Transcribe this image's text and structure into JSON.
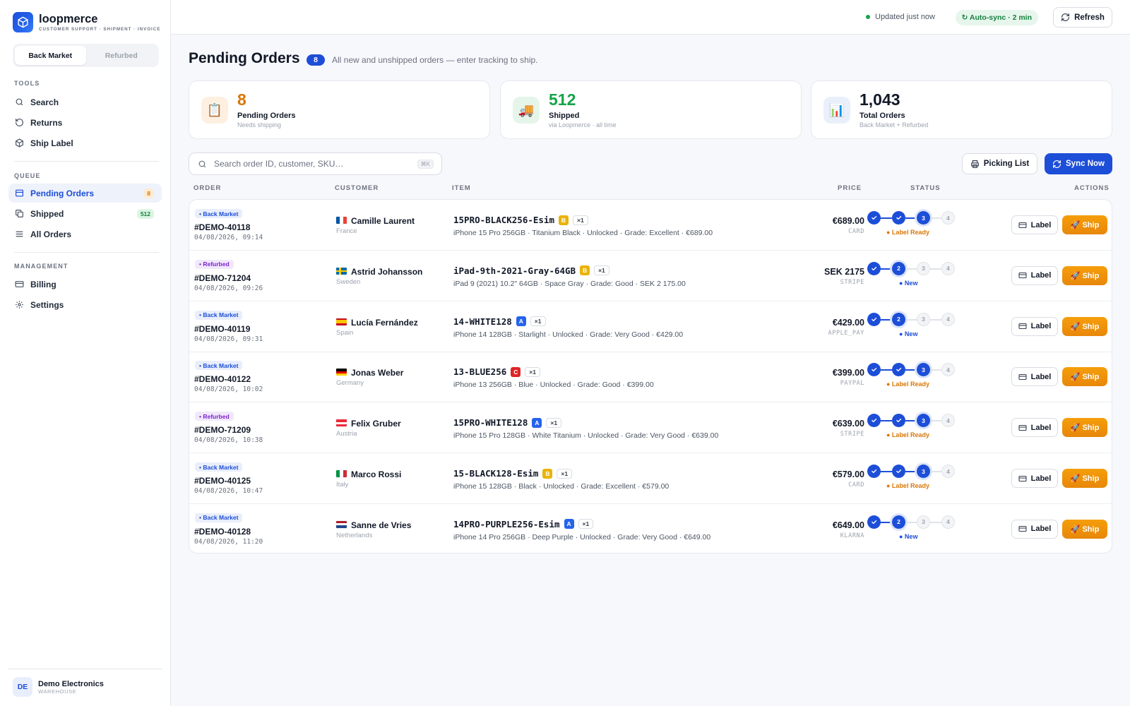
{
  "brand": {
    "name": "loopmerce",
    "tagline": "CUSTOMER SUPPORT · SHIPMENT · INVOICE"
  },
  "marketplace_tabs": [
    {
      "label": "Back Market",
      "active": true
    },
    {
      "label": "Refurbed",
      "active": false
    }
  ],
  "sidebar": {
    "tools_title": "TOOLS",
    "tools": [
      {
        "label": "Search",
        "icon": "search-icon"
      },
      {
        "label": "Returns",
        "icon": "undo-icon"
      },
      {
        "label": "Ship Label",
        "icon": "box-icon"
      }
    ],
    "queue_title": "QUEUE",
    "queue": [
      {
        "label": "Pending Orders",
        "icon": "inbox-icon",
        "badge": "8",
        "active": true
      },
      {
        "label": "Shipped",
        "icon": "copy-icon",
        "badge": "512",
        "active": false
      },
      {
        "label": "All Orders",
        "icon": "list-icon",
        "badge": "",
        "active": false
      }
    ],
    "management_title": "MANAGEMENT",
    "management": [
      {
        "label": "Billing",
        "icon": "credit-card-icon"
      },
      {
        "label": "Settings",
        "icon": "gear-icon"
      }
    ]
  },
  "org": {
    "initials": "DE",
    "name": "Demo Electronics",
    "role": "WAREHOUSE"
  },
  "topbar": {
    "updated": "Updated just now",
    "autosync": "↻ Auto-sync · 2 min",
    "refresh_label": "Refresh"
  },
  "page": {
    "title": "Pending Orders",
    "count": "8",
    "subtitle": "All new and unshipped orders — enter tracking to ship."
  },
  "stats": [
    {
      "value": "8",
      "label": "Pending Orders",
      "sub": "Needs shipping",
      "icon": "📋",
      "color": "#d97706",
      "bg": "#fdf0e1"
    },
    {
      "value": "512",
      "label": "Shipped",
      "sub": "via Loopmerce · all time",
      "icon": "🚚",
      "color": "#16a34a",
      "bg": "#e5f5ea"
    },
    {
      "value": "1,043",
      "label": "Total Orders",
      "sub": "Back Market + Refurbed",
      "icon": "📊",
      "color": "#111827",
      "bg": "#eaf0fb"
    }
  ],
  "toolbar": {
    "search_placeholder": "Search order ID, customer, SKU…",
    "shortcut": "⌘K",
    "picking_label": "Picking List",
    "sync_label": "Sync Now"
  },
  "table": {
    "headers": {
      "order": "ORDER",
      "customer": "CUSTOMER",
      "item": "ITEM",
      "price": "PRICE",
      "status": "STATUS",
      "actions": "ACTIONS"
    },
    "label_button": "Label",
    "ship_button": "🚀 Ship",
    "rows": [
      {
        "channel": "• Back Market",
        "channel_type": "bm",
        "order_id": "#DEMO-40118",
        "date": "04/08/2026, 09:14",
        "flag": "fr",
        "customer": "Camille Laurent",
        "country": "France",
        "sku": "15PRO-BLACK256-Esim",
        "grade": "B",
        "qty": "×1",
        "desc": "iPhone 15 Pro 256GB · Titanium Black · Unlocked · Grade: Excellent · €689.00",
        "price": "€689.00",
        "payment": "CARD",
        "step": 3,
        "status": "● Label Ready"
      },
      {
        "channel": "• Refurbed",
        "channel_type": "rf",
        "order_id": "#DEMO-71204",
        "date": "04/08/2026, 09:26",
        "flag": "se",
        "customer": "Astrid Johansson",
        "country": "Sweden",
        "sku": "iPad-9th-2021-Gray-64GB",
        "grade": "B",
        "qty": "×1",
        "desc": "iPad 9 (2021) 10.2\" 64GB · Space Gray · Grade: Good · SEK 2 175.00",
        "price": "SEK 2175",
        "payment": "STRIPE",
        "step": 2,
        "status": "● New"
      },
      {
        "channel": "• Back Market",
        "channel_type": "bm",
        "order_id": "#DEMO-40119",
        "date": "04/08/2026, 09:31",
        "flag": "es",
        "customer": "Lucía Fernández",
        "country": "Spain",
        "sku": "14-WHITE128",
        "grade": "A",
        "qty": "×1",
        "desc": "iPhone 14 128GB · Starlight · Unlocked · Grade: Very Good · €429.00",
        "price": "€429.00",
        "payment": "APPLE_PAY",
        "step": 2,
        "status": "● New"
      },
      {
        "channel": "• Back Market",
        "channel_type": "bm",
        "order_id": "#DEMO-40122",
        "date": "04/08/2026, 10:02",
        "flag": "de",
        "customer": "Jonas Weber",
        "country": "Germany",
        "sku": "13-BLUE256",
        "grade": "C",
        "qty": "×1",
        "desc": "iPhone 13 256GB · Blue · Unlocked · Grade: Good · €399.00",
        "price": "€399.00",
        "payment": "PAYPAL",
        "step": 3,
        "status": "● Label Ready"
      },
      {
        "channel": "• Refurbed",
        "channel_type": "rf",
        "order_id": "#DEMO-71209",
        "date": "04/08/2026, 10:38",
        "flag": "at",
        "customer": "Felix Gruber",
        "country": "Austria",
        "sku": "15PRO-WHITE128",
        "grade": "A",
        "qty": "×1",
        "desc": "iPhone 15 Pro 128GB · White Titanium · Unlocked · Grade: Very Good · €639.00",
        "price": "€639.00",
        "payment": "STRIPE",
        "step": 3,
        "status": "● Label Ready"
      },
      {
        "channel": "• Back Market",
        "channel_type": "bm",
        "order_id": "#DEMO-40125",
        "date": "04/08/2026, 10:47",
        "flag": "it",
        "customer": "Marco Rossi",
        "country": "Italy",
        "sku": "15-BLACK128-Esim",
        "grade": "B",
        "qty": "×1",
        "desc": "iPhone 15 128GB · Black · Unlocked · Grade: Excellent · €579.00",
        "price": "€579.00",
        "payment": "CARD",
        "step": 3,
        "status": "● Label Ready"
      },
      {
        "channel": "• Back Market",
        "channel_type": "bm",
        "order_id": "#DEMO-40128",
        "date": "04/08/2026, 11:20",
        "flag": "nl",
        "customer": "Sanne de Vries",
        "country": "Netherlands",
        "sku": "14PRO-PURPLE256-Esim",
        "grade": "A",
        "qty": "×1",
        "desc": "iPhone 14 Pro 256GB · Deep Purple · Unlocked · Grade: Very Good · €649.00",
        "price": "€649.00",
        "payment": "KLARNA",
        "step": 2,
        "status": "● New"
      }
    ]
  },
  "colors": {
    "accent": "#1d4ed8",
    "ship": "#f59e0b",
    "grade_A": "#2563eb",
    "grade_B": "#eab308",
    "grade_C": "#dc2626",
    "status_ready": "#d97706",
    "status_new": "#1d4ed8"
  }
}
